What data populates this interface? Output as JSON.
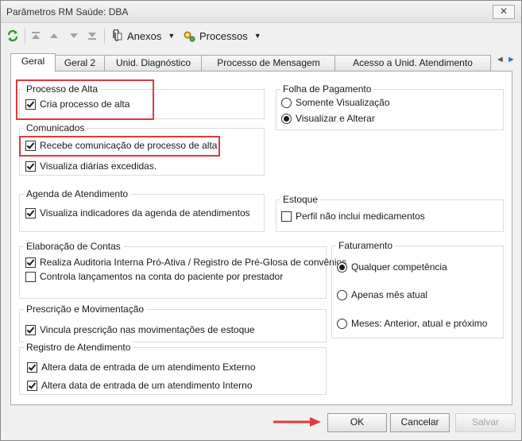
{
  "window": {
    "title": "Parâmetros RM Saúde: DBA",
    "close_label": "✕"
  },
  "toolbar": {
    "refresh_icon": "refresh-icon",
    "first_icon": "first-record-icon",
    "prev_icon": "previous-record-icon",
    "next_icon": "next-record-icon",
    "last_icon": "last-record-icon",
    "anexos_label": "Anexos",
    "processos_label": "Processos"
  },
  "tabs": [
    {
      "label": "Geral",
      "active": true
    },
    {
      "label": "Geral 2"
    },
    {
      "label": "Unid. Diagnóstico"
    },
    {
      "label": "Processo de Mensagem"
    },
    {
      "label": "Acesso a Unid. Atendimento"
    }
  ],
  "groups": {
    "processo_alta": {
      "legend": "Processo de Alta",
      "items": [
        {
          "label": "Cria processo de alta",
          "checked": true
        }
      ]
    },
    "comunicados": {
      "legend": "Comunicados",
      "items": [
        {
          "label": "Recebe comunicação de processo de alta",
          "checked": true
        },
        {
          "label": "Visualiza diárias excedidas.",
          "checked": true
        }
      ]
    },
    "folha": {
      "legend": "Folha de Pagamento",
      "options": [
        {
          "label": "Somente Visualização",
          "checked": false
        },
        {
          "label": "Visualizar e Alterar",
          "checked": true
        }
      ]
    },
    "agenda": {
      "legend": "Agenda de Atendimento",
      "items": [
        {
          "label": "Visualiza indicadores da agenda de atendimentos",
          "checked": true
        }
      ]
    },
    "estoque": {
      "legend": "Estoque",
      "items": [
        {
          "label": "Perfil não inclui medicamentos",
          "checked": false
        }
      ]
    },
    "elaboracao": {
      "legend": "Elaboração de Contas",
      "items": [
        {
          "label": "Realiza Auditoria Interna Pró-Ativa / Registro de Pré-Glosa de convênios",
          "checked": true
        },
        {
          "label": "Controla lançamentos na conta do paciente por prestador",
          "checked": false
        }
      ]
    },
    "faturamento": {
      "legend": "Faturamento",
      "options": [
        {
          "label": "Qualquer competência",
          "checked": true
        },
        {
          "label": "Apenas mês atual",
          "checked": false
        },
        {
          "label": "Meses: Anterior, atual e próximo",
          "checked": false
        }
      ]
    },
    "prescricao": {
      "legend": "Prescrição e Movimentação",
      "items": [
        {
          "label": "Vincula prescrição nas movimentações de estoque",
          "checked": true
        }
      ]
    },
    "registro": {
      "legend": "Registro de Atendimento",
      "items": [
        {
          "label": "Altera data de entrada de um atendimento Externo",
          "checked": true
        },
        {
          "label": "Altera data de entrada de um atendimento Interno",
          "checked": true
        }
      ]
    }
  },
  "buttons": {
    "ok": "OK",
    "cancel": "Cancelar",
    "save": "Salvar"
  },
  "colors": {
    "highlight": "#e0393e",
    "accent": "#2b6fd6"
  }
}
